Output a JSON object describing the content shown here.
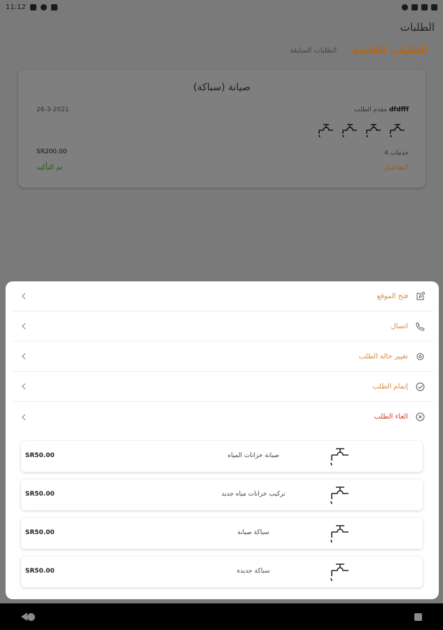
{
  "status_bar": {
    "time": "11:12"
  },
  "app_bar": {
    "title": "الطلبات"
  },
  "tabs": [
    {
      "label": "الطلبات القائمة",
      "active": true
    },
    {
      "label": "الطلبات السابقة",
      "active": false
    }
  ],
  "order": {
    "title": "صيانة (سباكة)",
    "provider_label": "مقدم الطلب",
    "provider_name": "dfdfff",
    "date": "26-3-2021",
    "services_count": "4 خدمات",
    "price": "SR200.00",
    "details_label": "التفاصيل",
    "status": "تم التأكيد",
    "tap_icons": [
      "faucet-icon",
      "faucet-icon",
      "faucet-icon",
      "faucet-icon"
    ]
  },
  "actions": [
    {
      "label": "فتح الموقع",
      "icon": "edit-icon",
      "color": "#d78a3e"
    },
    {
      "label": "اتصال",
      "icon": "phone-icon",
      "color": "#d78a3e"
    },
    {
      "label": "تغيير حالة الطلب",
      "icon": "gear-icon",
      "color": "#d78a3e"
    },
    {
      "label": "إتمام الطلب",
      "icon": "check-circle-icon",
      "color": "#d78a3e"
    },
    {
      "label": "الغاء الطلب",
      "icon": "cancel-circle-icon",
      "color": "#d33a2c"
    }
  ],
  "services": [
    {
      "name": "صيانة خزانات المياه",
      "price": "SR50.00",
      "icon": "faucet-icon"
    },
    {
      "name": "تركيب خزانات مياه جديد",
      "price": "SR50.00",
      "icon": "faucet-icon"
    },
    {
      "name": "سباكة صيانة",
      "price": "SR50.00",
      "icon": "faucet-icon"
    },
    {
      "name": "سباكة جديدة",
      "price": "SR50.00",
      "icon": "faucet-icon"
    }
  ],
  "colors": {
    "accent": "#d78a3e",
    "danger": "#d33a2c",
    "success": "#1f5d10"
  }
}
